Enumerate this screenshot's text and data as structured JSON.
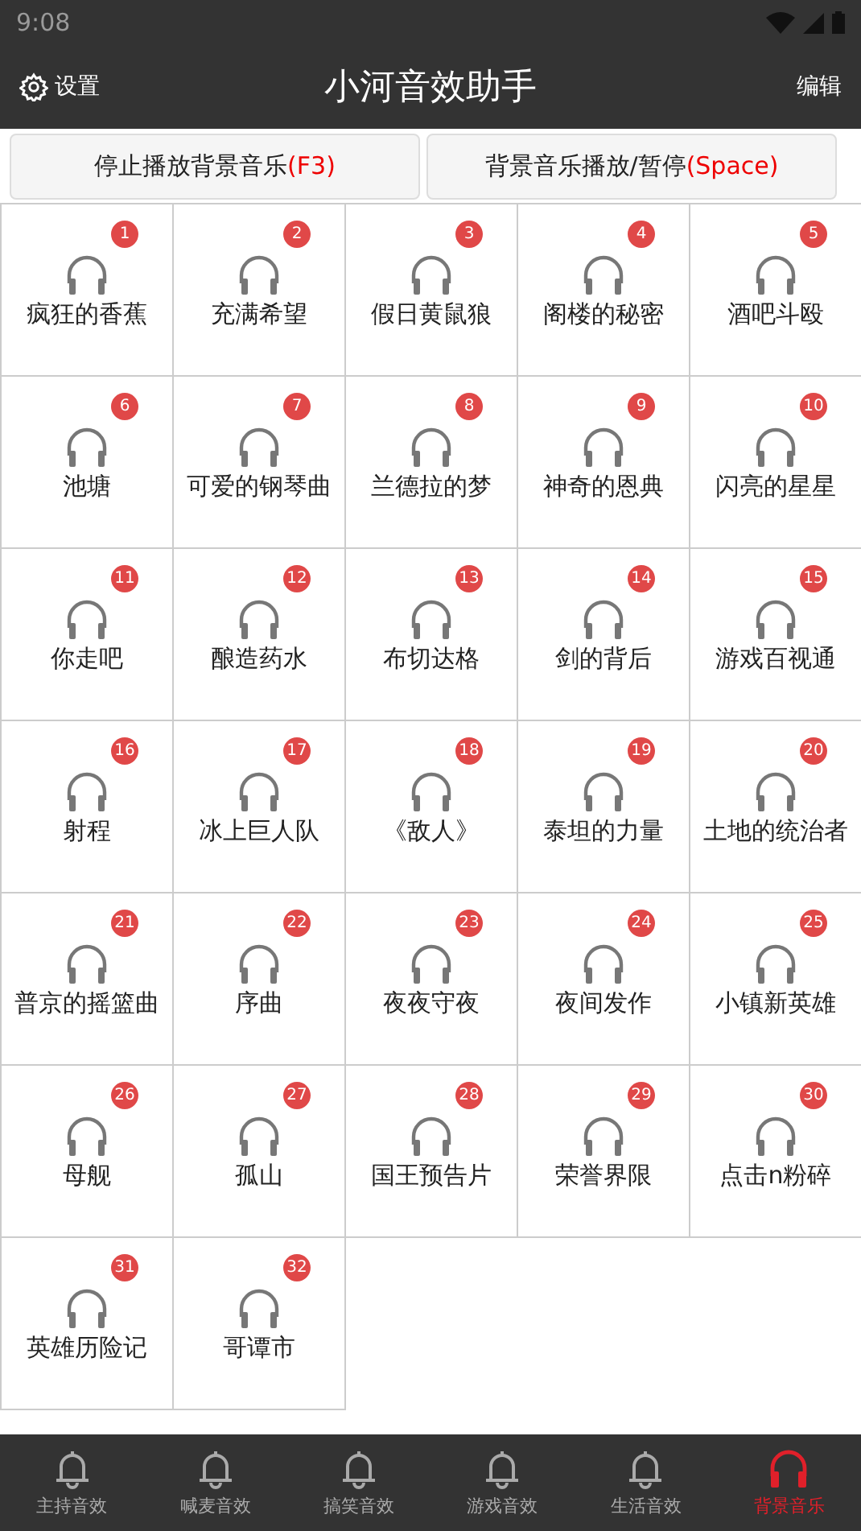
{
  "status_bar": {
    "time": "9:08"
  },
  "header": {
    "settings": "设置",
    "title": "小河音效助手",
    "edit": "编辑"
  },
  "buttons": [
    {
      "label": "停止播放背景音乐",
      "shortcut": "(F3)"
    },
    {
      "label": "背景音乐播放/暂停",
      "shortcut": "(Space)"
    }
  ],
  "sounds": [
    {
      "number": "1",
      "name": "疯狂的香蕉"
    },
    {
      "number": "2",
      "name": "充满希望"
    },
    {
      "number": "3",
      "name": "假日黄鼠狼"
    },
    {
      "number": "4",
      "name": "阁楼的秘密"
    },
    {
      "number": "5",
      "name": "酒吧斗殴"
    },
    {
      "number": "6",
      "name": "池塘"
    },
    {
      "number": "7",
      "name": "可爱的钢琴曲"
    },
    {
      "number": "8",
      "name": "兰德拉的梦"
    },
    {
      "number": "9",
      "name": "神奇的恩典"
    },
    {
      "number": "10",
      "name": "闪亮的星星"
    },
    {
      "number": "11",
      "name": "你走吧"
    },
    {
      "number": "12",
      "name": "酿造药水"
    },
    {
      "number": "13",
      "name": "布切达格"
    },
    {
      "number": "14",
      "name": "剑的背后"
    },
    {
      "number": "15",
      "name": "游戏百视通"
    },
    {
      "number": "16",
      "name": "射程"
    },
    {
      "number": "17",
      "name": "冰上巨人队"
    },
    {
      "number": "18",
      "name": "《敌人》"
    },
    {
      "number": "19",
      "name": "泰坦的力量"
    },
    {
      "number": "20",
      "name": "土地的统治者"
    },
    {
      "number": "21",
      "name": "普京的摇篮曲"
    },
    {
      "number": "22",
      "name": "序曲"
    },
    {
      "number": "23",
      "name": "夜夜守夜"
    },
    {
      "number": "24",
      "name": "夜间发作"
    },
    {
      "number": "25",
      "name": "小镇新英雄"
    },
    {
      "number": "26",
      "name": "母舰"
    },
    {
      "number": "27",
      "name": "孤山"
    },
    {
      "number": "28",
      "name": "国王预告片"
    },
    {
      "number": "29",
      "name": "荣誉界限"
    },
    {
      "number": "30",
      "name": "点击n粉碎"
    },
    {
      "number": "31",
      "name": "英雄历险记"
    },
    {
      "number": "32",
      "name": "哥谭市"
    }
  ],
  "tabs": [
    {
      "label": "主持音效",
      "kind": "bell",
      "selected": false
    },
    {
      "label": "喊麦音效",
      "kind": "bell",
      "selected": false
    },
    {
      "label": "搞笑音效",
      "kind": "bell",
      "selected": false
    },
    {
      "label": "游戏音效",
      "kind": "bell",
      "selected": false
    },
    {
      "label": "生活音效",
      "kind": "bell",
      "selected": false
    },
    {
      "label": "背景音乐",
      "kind": "headphones",
      "selected": true
    }
  ]
}
